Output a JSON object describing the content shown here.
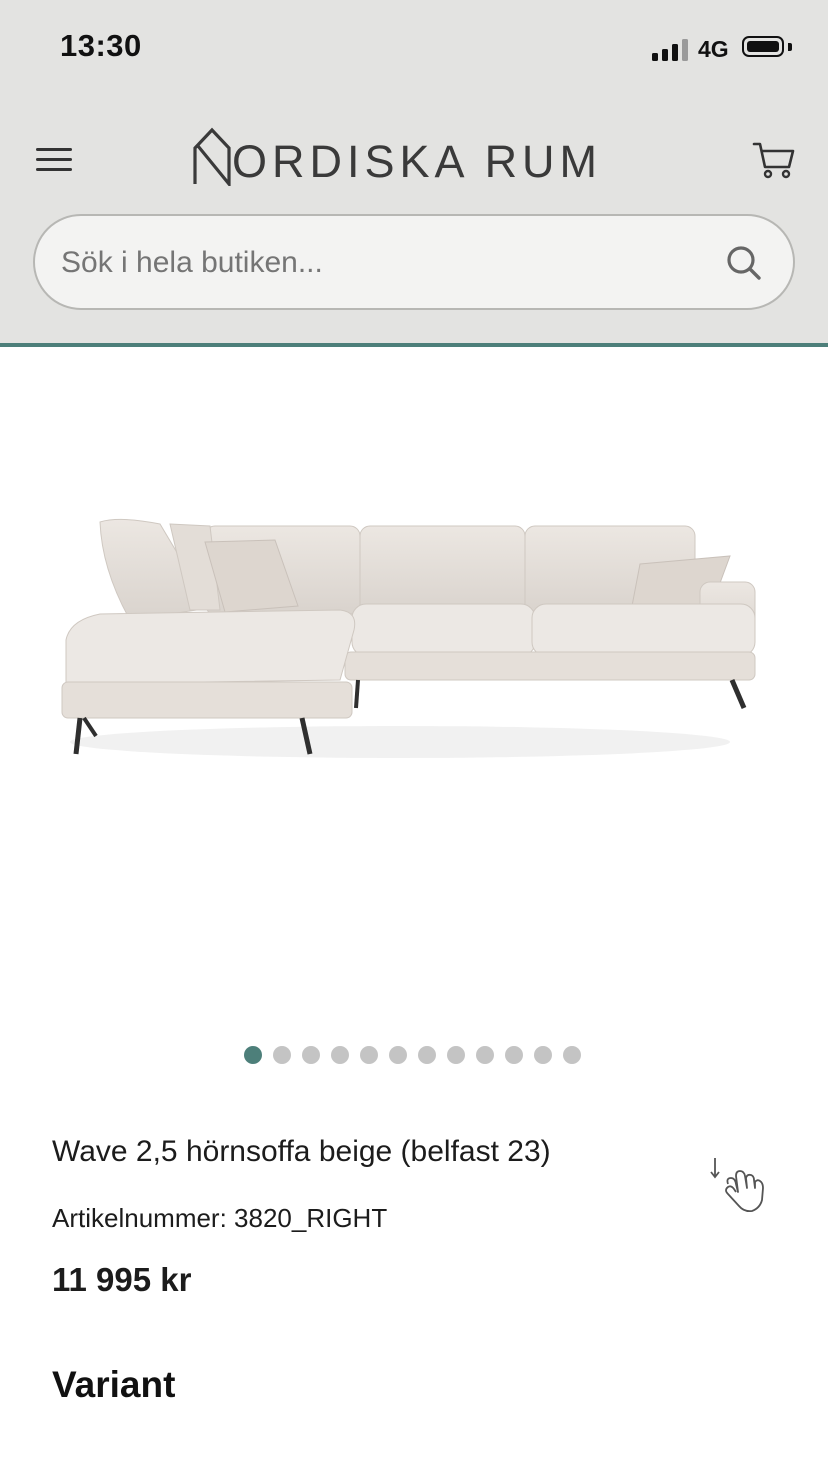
{
  "status_bar": {
    "time": "13:30",
    "network": "4G",
    "icons": [
      "signal-icon",
      "battery-icon"
    ]
  },
  "header": {
    "logo_text": "ORDISKA RUM",
    "menu_icon": "hamburger-menu-icon",
    "cart_icon": "cart-icon",
    "accent_color": "#4d7f7a"
  },
  "search": {
    "placeholder": "Sök i hela butiken...",
    "value": "",
    "icon": "search-icon"
  },
  "gallery": {
    "image_alt": "Wave 2,5 hörnsoffa beige (belfast 23)",
    "total_images": 12,
    "active_index": 0
  },
  "product": {
    "title": "Wave 2,5 hörnsoffa beige (belfast 23)",
    "sku_label": "Artikelnummer: 3820_RIGHT",
    "price": "11 995 kr",
    "hint_icon": "swipe-down-hand-icon"
  },
  "variant": {
    "heading": "Variant"
  }
}
